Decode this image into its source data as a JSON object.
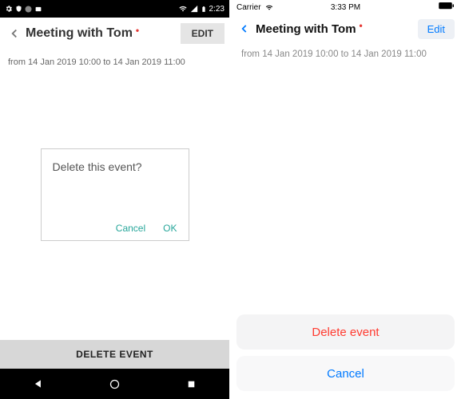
{
  "android": {
    "status": {
      "time": "2:23"
    },
    "header": {
      "title": "Meeting with Tom",
      "edit_label": "EDIT"
    },
    "dates": "from 14 Jan 2019 10:00 to 14 Jan 2019 11:00",
    "dialog": {
      "message": "Delete this event?",
      "cancel": "Cancel",
      "ok": "OK"
    },
    "delete_bar": "DELETE EVENT"
  },
  "ios": {
    "status": {
      "carrier": "Carrier",
      "time": "3:33 PM"
    },
    "header": {
      "title": "Meeting with Tom",
      "edit_label": "Edit"
    },
    "dates": "from 14 Jan 2019 10:00 to 14 Jan 2019 11:00",
    "actionsheet": {
      "delete": "Delete event",
      "cancel": "Cancel"
    }
  }
}
